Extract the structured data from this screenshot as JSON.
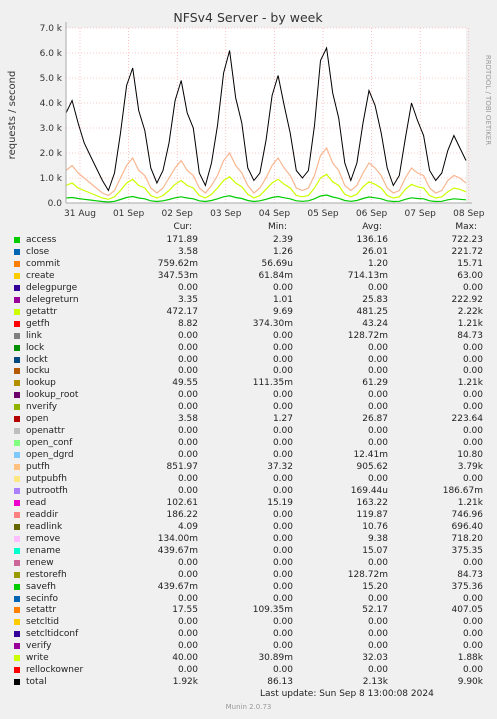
{
  "chart_data": {
    "type": "line",
    "title": "NFSv4 Server - by week",
    "ylabel": "requests / second",
    "side_label": "RRDTOOL / TOBI OETIKER",
    "ylim": [
      0,
      7000
    ],
    "yticks": [
      "0.0",
      "1.0 k",
      "2.0 k",
      "3.0 k",
      "4.0 k",
      "5.0 k",
      "6.0 k",
      "7.0 k"
    ],
    "x_ticks": [
      "31 Aug",
      "01 Sep",
      "02 Sep",
      "03 Sep",
      "04 Sep",
      "05 Sep",
      "06 Sep",
      "07 Sep",
      "08 Sep"
    ],
    "grid": true,
    "series": [
      {
        "name": "total",
        "color": "#000000",
        "avg": 2130,
        "max": 6200,
        "values": [
          3600,
          4100,
          3200,
          2400,
          1900,
          1400,
          900,
          500,
          1200,
          2800,
          4700,
          5400,
          3700,
          2900,
          1400,
          800,
          1300,
          2400,
          4100,
          4900,
          3600,
          3000,
          1200,
          700,
          1600,
          3100,
          5200,
          6100,
          4200,
          3200,
          1400,
          900,
          1200,
          2500,
          4300,
          5100,
          3900,
          2800,
          1300,
          1000,
          1300,
          3100,
          5700,
          6200,
          4400,
          3400,
          1600,
          900,
          1600,
          3200,
          4500,
          3900,
          2800,
          1400,
          700,
          1100,
          2600,
          4000,
          3300,
          2700,
          1300,
          900,
          1200,
          2100,
          2700,
          2200,
          1700
        ]
      },
      {
        "name": "putfh",
        "color": "#f8b690",
        "avg": 905,
        "max": 3790,
        "values": [
          1300,
          1500,
          1200,
          1000,
          800,
          600,
          400,
          300,
          500,
          1000,
          1500,
          1800,
          1300,
          1100,
          600,
          400,
          600,
          1000,
          1400,
          1700,
          1300,
          1100,
          600,
          400,
          700,
          1100,
          1700,
          2000,
          1500,
          1200,
          700,
          400,
          600,
          1000,
          1500,
          1800,
          1400,
          1100,
          600,
          500,
          600,
          1100,
          1900,
          2200,
          1600,
          1300,
          700,
          500,
          700,
          1200,
          1600,
          1400,
          1100,
          600,
          400,
          500,
          1000,
          1400,
          1200,
          1100,
          600,
          400,
          500,
          900,
          1100,
          1000,
          800
        ]
      },
      {
        "name": "getattr",
        "color": "#ccff00",
        "avg": 481,
        "max": 2220,
        "values": [
          700,
          800,
          600,
          500,
          400,
          300,
          200,
          150,
          250,
          500,
          800,
          950,
          700,
          600,
          300,
          200,
          300,
          500,
          750,
          900,
          700,
          600,
          300,
          200,
          350,
          600,
          900,
          1050,
          800,
          650,
          350,
          200,
          300,
          550,
          800,
          950,
          750,
          600,
          300,
          250,
          300,
          600,
          1000,
          1150,
          850,
          700,
          350,
          250,
          350,
          650,
          850,
          750,
          600,
          300,
          200,
          250,
          550,
          750,
          650,
          600,
          300,
          200,
          250,
          450,
          600,
          550,
          450
        ]
      },
      {
        "name": "access",
        "color": "#00cc00",
        "avg": 136,
        "max": 722,
        "values": [
          200,
          220,
          180,
          150,
          120,
          90,
          60,
          40,
          70,
          140,
          220,
          260,
          200,
          170,
          90,
          60,
          90,
          140,
          210,
          250,
          200,
          170,
          90,
          60,
          100,
          170,
          250,
          290,
          220,
          180,
          100,
          60,
          90,
          150,
          220,
          260,
          210,
          170,
          90,
          70,
          90,
          170,
          280,
          320,
          240,
          190,
          100,
          70,
          100,
          180,
          240,
          210,
          170,
          90,
          60,
          70,
          150,
          210,
          180,
          170,
          90,
          60,
          70,
          130,
          170,
          150,
          130
        ]
      }
    ],
    "legend": {
      "headers": [
        "Cur:",
        "Min:",
        "Avg:",
        "Max:"
      ],
      "rows": [
        {
          "name": "access",
          "color": "#00cc00",
          "cur": "171.89",
          "min": "2.39",
          "avg": "136.16",
          "max": "722.23"
        },
        {
          "name": "close",
          "color": "#0066b3",
          "cur": "3.58",
          "min": "1.26",
          "avg": "26.01",
          "max": "221.72"
        },
        {
          "name": "commit",
          "color": "#ff8000",
          "cur": "759.62m",
          "min": "56.69u",
          "avg": "1.20",
          "max": "15.71"
        },
        {
          "name": "create",
          "color": "#ffcc00",
          "cur": "347.53m",
          "min": "61.84m",
          "avg": "714.13m",
          "max": "63.00"
        },
        {
          "name": "delegpurge",
          "color": "#330099",
          "cur": "0.00",
          "min": "0.00",
          "avg": "0.00",
          "max": "0.00"
        },
        {
          "name": "delegreturn",
          "color": "#990099",
          "cur": "3.35",
          "min": "1.01",
          "avg": "25.83",
          "max": "222.92"
        },
        {
          "name": "getattr",
          "color": "#ccff00",
          "cur": "472.17",
          "min": "9.69",
          "avg": "481.25",
          "max": "2.22k"
        },
        {
          "name": "getfh",
          "color": "#ff0000",
          "cur": "8.82",
          "min": "374.30m",
          "avg": "43.24",
          "max": "1.21k"
        },
        {
          "name": "link",
          "color": "#808080",
          "cur": "0.00",
          "min": "0.00",
          "avg": "128.72m",
          "max": "84.73"
        },
        {
          "name": "lock",
          "color": "#008f00",
          "cur": "0.00",
          "min": "0.00",
          "avg": "0.00",
          "max": "0.00"
        },
        {
          "name": "lockt",
          "color": "#00487d",
          "cur": "0.00",
          "min": "0.00",
          "avg": "0.00",
          "max": "0.00"
        },
        {
          "name": "locku",
          "color": "#b35a00",
          "cur": "0.00",
          "min": "0.00",
          "avg": "0.00",
          "max": "0.00"
        },
        {
          "name": "lookup",
          "color": "#b38f00",
          "cur": "49.55",
          "min": "111.35m",
          "avg": "61.29",
          "max": "1.21k"
        },
        {
          "name": "lookup_root",
          "color": "#6b006b",
          "cur": "0.00",
          "min": "0.00",
          "avg": "0.00",
          "max": "0.00"
        },
        {
          "name": "nverify",
          "color": "#8fb300",
          "cur": "0.00",
          "min": "0.00",
          "avg": "0.00",
          "max": "0.00"
        },
        {
          "name": "open",
          "color": "#b30000",
          "cur": "3.58",
          "min": "1.27",
          "avg": "26.87",
          "max": "223.64"
        },
        {
          "name": "openattr",
          "color": "#bebebe",
          "cur": "0.00",
          "min": "0.00",
          "avg": "0.00",
          "max": "0.00"
        },
        {
          "name": "open_conf",
          "color": "#80ff80",
          "cur": "0.00",
          "min": "0.00",
          "avg": "0.00",
          "max": "0.00"
        },
        {
          "name": "open_dgrd",
          "color": "#80c9ff",
          "cur": "0.00",
          "min": "0.00",
          "avg": "12.41m",
          "max": "10.80"
        },
        {
          "name": "putfh",
          "color": "#ffc080",
          "cur": "851.97",
          "min": "37.32",
          "avg": "905.62",
          "max": "3.79k"
        },
        {
          "name": "putpubfh",
          "color": "#ffe680",
          "cur": "0.00",
          "min": "0.00",
          "avg": "0.00",
          "max": "0.00"
        },
        {
          "name": "putrootfh",
          "color": "#aa80ff",
          "cur": "0.00",
          "min": "0.00",
          "avg": "169.44u",
          "max": "186.67m"
        },
        {
          "name": "read",
          "color": "#ee00cc",
          "cur": "102.61",
          "min": "15.19",
          "avg": "163.22",
          "max": "1.21k"
        },
        {
          "name": "readdir",
          "color": "#ff8080",
          "cur": "186.22",
          "min": "0.00",
          "avg": "119.87",
          "max": "746.96"
        },
        {
          "name": "readlink",
          "color": "#666600",
          "cur": "4.09",
          "min": "0.00",
          "avg": "10.76",
          "max": "696.40"
        },
        {
          "name": "remove",
          "color": "#ffbfff",
          "cur": "134.00m",
          "min": "0.00",
          "avg": "9.38",
          "max": "718.20"
        },
        {
          "name": "rename",
          "color": "#00ffcc",
          "cur": "439.67m",
          "min": "0.00",
          "avg": "15.07",
          "max": "375.35"
        },
        {
          "name": "renew",
          "color": "#cc6699",
          "cur": "0.00",
          "min": "0.00",
          "avg": "0.00",
          "max": "0.00"
        },
        {
          "name": "restorefh",
          "color": "#999900",
          "cur": "0.00",
          "min": "0.00",
          "avg": "128.72m",
          "max": "84.73"
        },
        {
          "name": "savefh",
          "color": "#00cc00",
          "cur": "439.67m",
          "min": "0.00",
          "avg": "15.20",
          "max": "375.36"
        },
        {
          "name": "secinfo",
          "color": "#0066b3",
          "cur": "0.00",
          "min": "0.00",
          "avg": "0.00",
          "max": "0.00"
        },
        {
          "name": "setattr",
          "color": "#ff8000",
          "cur": "17.55",
          "min": "109.35m",
          "avg": "52.17",
          "max": "407.05"
        },
        {
          "name": "setcltid",
          "color": "#ffcc00",
          "cur": "0.00",
          "min": "0.00",
          "avg": "0.00",
          "max": "0.00"
        },
        {
          "name": "setcltidconf",
          "color": "#330099",
          "cur": "0.00",
          "min": "0.00",
          "avg": "0.00",
          "max": "0.00"
        },
        {
          "name": "verify",
          "color": "#990099",
          "cur": "0.00",
          "min": "0.00",
          "avg": "0.00",
          "max": "0.00"
        },
        {
          "name": "write",
          "color": "#ccff00",
          "cur": "40.00",
          "min": "30.89m",
          "avg": "32.03",
          "max": "1.88k"
        },
        {
          "name": "rellockowner",
          "color": "#ff0000",
          "cur": "0.00",
          "min": "0.00",
          "avg": "0.00",
          "max": "0.00"
        },
        {
          "name": "total",
          "color": "#000000",
          "cur": "1.92k",
          "min": "86.13",
          "avg": "2.13k",
          "max": "9.90k"
        }
      ]
    }
  },
  "footer": {
    "last_update": "Last update: Sun Sep  8 13:00:08 2024",
    "munin": "Munin 2.0.73"
  }
}
